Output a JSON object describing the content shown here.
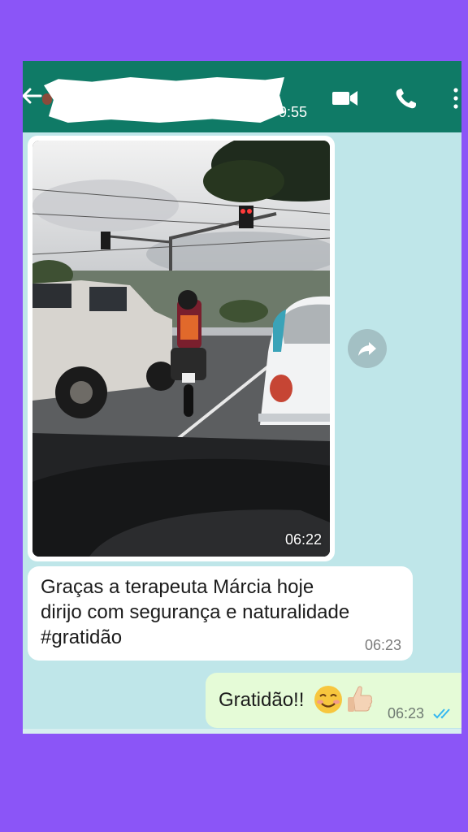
{
  "header": {
    "time_fragment": "9:55",
    "icons": {
      "back": "arrow-left-icon",
      "video": "video-call-icon",
      "call": "phone-call-icon",
      "menu": "more-vertical-icon"
    }
  },
  "photo_message": {
    "time": "06:22"
  },
  "incoming_message": {
    "text_line1": "Graças a terapeuta Márcia hoje",
    "text_line2": "dirijo com segurança e naturalidade",
    "text_line3": "#gratidão",
    "time": "06:23"
  },
  "outgoing_message": {
    "text": "Gratidão!!",
    "time": "06:23",
    "emojis": [
      "smiling-face-icon",
      "thumbs-up-icon"
    ]
  },
  "colors": {
    "background": "#8b55f7",
    "header": "#0f7a66",
    "chat_bg": "#bfe6e9",
    "outgoing_bubble": "#e5fbd7",
    "read_ticks": "#34b7f1"
  }
}
